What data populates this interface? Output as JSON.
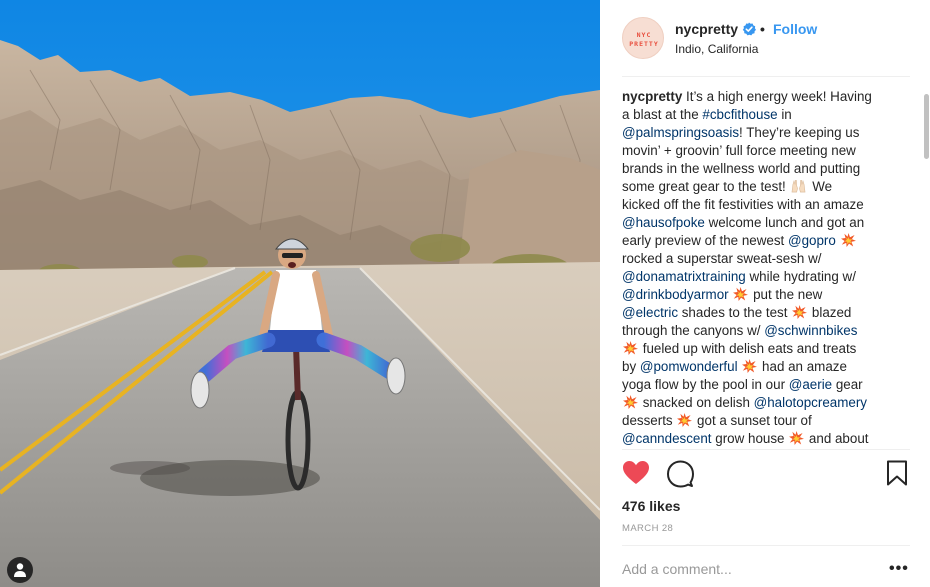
{
  "post": {
    "username": "nycpretty",
    "dot": "•",
    "follow_label": "Follow",
    "location": "Indio, California",
    "avatar_logo": [
      "NYC",
      "PRETTY"
    ],
    "likes": "476 likes",
    "date": "MARCH 28",
    "comment_placeholder": "Add a comment...",
    "more_label": "•••"
  },
  "caption": {
    "lines": [
      [
        {
          "t": "nycpretty",
          "k": "u"
        },
        {
          "t": " It’s a high energy week! Having"
        }
      ],
      [
        {
          "t": "a blast at the "
        },
        {
          "t": "#cbcfithouse",
          "k": "l"
        },
        {
          "t": " in"
        }
      ],
      [
        {
          "t": "@palmspringsoasis",
          "k": "l"
        },
        {
          "t": "! They’re keeping us"
        }
      ],
      [
        {
          "t": "movin’ + groovin’ full force meeting new"
        }
      ],
      [
        {
          "t": "brands in the wellness world and putting"
        }
      ],
      [
        {
          "t": "some great gear to the test! "
        },
        {
          "e": "hands"
        },
        {
          "t": " We"
        }
      ],
      [
        {
          "t": "kicked off the fit festivities with an amaze"
        }
      ],
      [
        {
          "t": "@hausofpoke",
          "k": "l"
        },
        {
          "t": " welcome lunch and got an"
        }
      ],
      [
        {
          "t": "early preview of the newest "
        },
        {
          "t": "@gopro",
          "k": "l"
        },
        {
          "t": " "
        },
        {
          "e": "burst"
        }
      ],
      [
        {
          "t": "rocked a superstar sweat-sesh w/"
        }
      ],
      [
        {
          "t": "@donamatrixtraining",
          "k": "l"
        },
        {
          "t": " while hydrating w/"
        }
      ],
      [
        {
          "t": "@drinkbodyarmor",
          "k": "l"
        },
        {
          "t": " "
        },
        {
          "e": "burst"
        },
        {
          "t": " put the new"
        }
      ],
      [
        {
          "t": "@electric",
          "k": "l"
        },
        {
          "t": " shades to the test "
        },
        {
          "e": "burst"
        },
        {
          "t": " blazed"
        }
      ],
      [
        {
          "t": "through the canyons w/ "
        },
        {
          "t": "@schwinnbikes",
          "k": "l"
        }
      ],
      [
        {
          "e": "burst"
        },
        {
          "t": " fueled up with delish eats and treats"
        }
      ],
      [
        {
          "t": "by "
        },
        {
          "t": "@pomwonderful",
          "k": "l"
        },
        {
          "t": " "
        },
        {
          "e": "burst"
        },
        {
          "t": " had an amaze"
        }
      ],
      [
        {
          "t": "yoga flow by the pool in our "
        },
        {
          "t": "@aerie",
          "k": "l"
        },
        {
          "t": " gear"
        }
      ],
      [
        {
          "e": "burst"
        },
        {
          "t": " snacked on delish "
        },
        {
          "t": "@halotopcreamery",
          "k": "l"
        }
      ],
      [
        {
          "t": "desserts "
        },
        {
          "e": "burst"
        },
        {
          "t": " got a sunset tour of"
        }
      ],
      [
        {
          "t": "@canndescent",
          "k": "l"
        },
        {
          "t": " grow house "
        },
        {
          "e": "burst"
        },
        {
          "t": " and about"
        }
      ]
    ]
  },
  "colors": {
    "link": "#003569",
    "follow": "#3897f0",
    "heart": "#ed4956",
    "verified": "#3897f0",
    "sky": "#1d8ee6"
  },
  "icons": {
    "like": "heart-filled-icon",
    "comment": "comment-bubble-icon",
    "save": "bookmark-icon",
    "verified": "verified-badge-icon",
    "tag": "user-tag-icon"
  }
}
